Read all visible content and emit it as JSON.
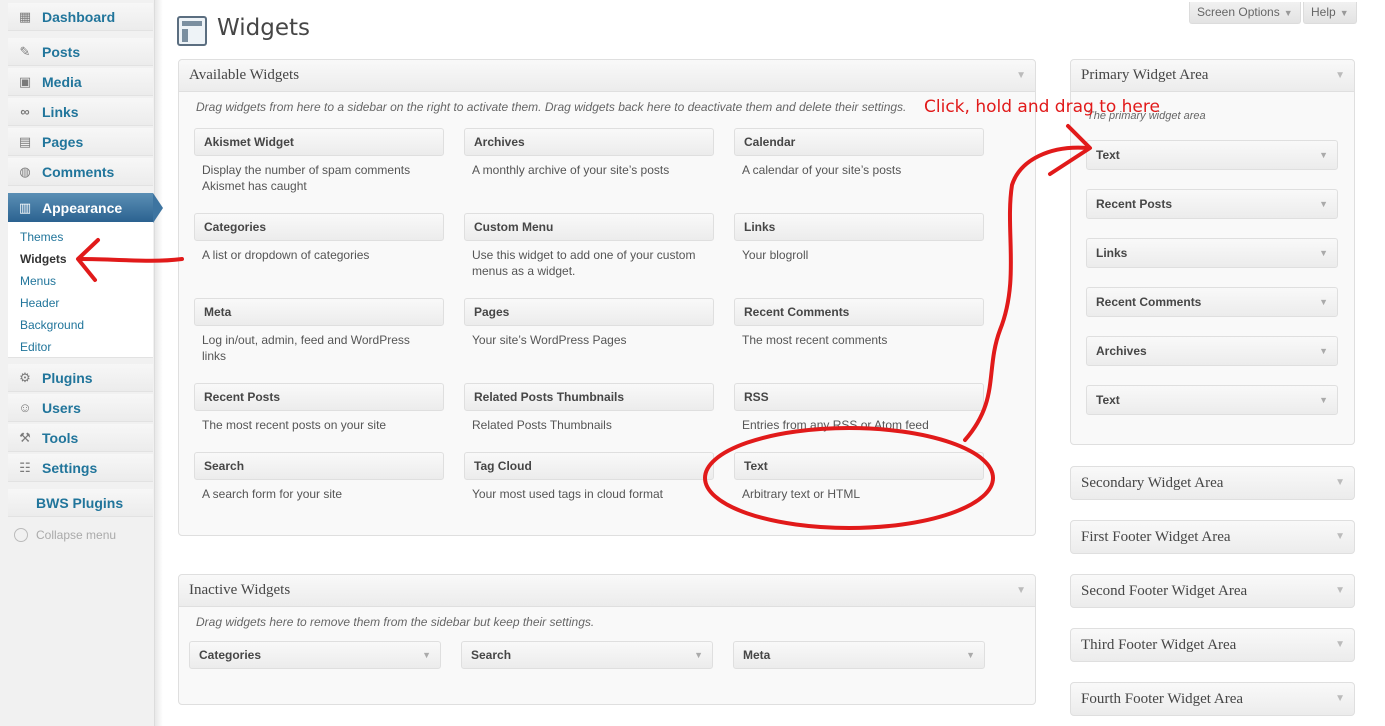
{
  "sidebar": {
    "items": [
      {
        "label": "Dashboard",
        "icon": "dashboard-icon"
      },
      {
        "label": "Posts",
        "icon": "pushpin-icon"
      },
      {
        "label": "Media",
        "icon": "media-icon"
      },
      {
        "label": "Links",
        "icon": "link-icon"
      },
      {
        "label": "Pages",
        "icon": "pages-icon"
      },
      {
        "label": "Comments",
        "icon": "comment-icon"
      },
      {
        "label": "Appearance",
        "icon": "appearance-icon"
      },
      {
        "label": "Plugins",
        "icon": "plugin-icon"
      },
      {
        "label": "Users",
        "icon": "users-icon"
      },
      {
        "label": "Tools",
        "icon": "tools-icon"
      },
      {
        "label": "Settings",
        "icon": "settings-icon"
      }
    ],
    "submenu": [
      "Themes",
      "Widgets",
      "Menus",
      "Header",
      "Background",
      "Editor"
    ],
    "bws_plugins": "BWS Plugins",
    "collapse": "Collapse menu"
  },
  "header": {
    "title": "Widgets",
    "screen_options": "Screen Options",
    "help": "Help"
  },
  "available": {
    "title": "Available Widgets",
    "description": "Drag widgets from here to a sidebar on the right to activate them. Drag widgets back here to deactivate them and delete their settings.",
    "widgets": [
      {
        "name": "Akismet Widget",
        "desc": "Display the number of spam comments Akismet has caught"
      },
      {
        "name": "Archives",
        "desc": "A monthly archive of your site’s posts"
      },
      {
        "name": "Calendar",
        "desc": "A calendar of your site’s posts"
      },
      {
        "name": "Categories",
        "desc": "A list or dropdown of categories"
      },
      {
        "name": "Custom Menu",
        "desc": "Use this widget to add one of your custom menus as a widget."
      },
      {
        "name": "Links",
        "desc": "Your blogroll"
      },
      {
        "name": "Meta",
        "desc": "Log in/out, admin, feed and WordPress links"
      },
      {
        "name": "Pages",
        "desc": "Your site’s WordPress Pages"
      },
      {
        "name": "Recent Comments",
        "desc": "The most recent comments"
      },
      {
        "name": "Recent Posts",
        "desc": "The most recent posts on your site"
      },
      {
        "name": "Related Posts Thumbnails",
        "desc": "Related Posts Thumbnails"
      },
      {
        "name": "RSS",
        "desc": "Entries from any RSS or Atom feed"
      },
      {
        "name": "Search",
        "desc": "A search form for your site"
      },
      {
        "name": "Tag Cloud",
        "desc": "Your most used tags in cloud format"
      },
      {
        "name": "Text",
        "desc": "Arbitrary text or HTML"
      }
    ]
  },
  "inactive": {
    "title": "Inactive Widgets",
    "description": "Drag widgets here to remove them from the sidebar but keep their settings.",
    "widgets": [
      "Categories",
      "Search",
      "Meta"
    ]
  },
  "primary": {
    "title": "Primary Widget Area",
    "description": "The primary widget area",
    "widgets": [
      "Text",
      "Recent Posts",
      "Links",
      "Recent Comments",
      "Archives",
      "Text"
    ]
  },
  "areas": [
    "Secondary Widget Area",
    "First Footer Widget Area",
    "Second Footer Widget Area",
    "Third Footer Widget Area",
    "Fourth Footer Widget Area"
  ],
  "annotation": {
    "text": "Click, hold and drag to here",
    "color": "#e11a1a"
  }
}
